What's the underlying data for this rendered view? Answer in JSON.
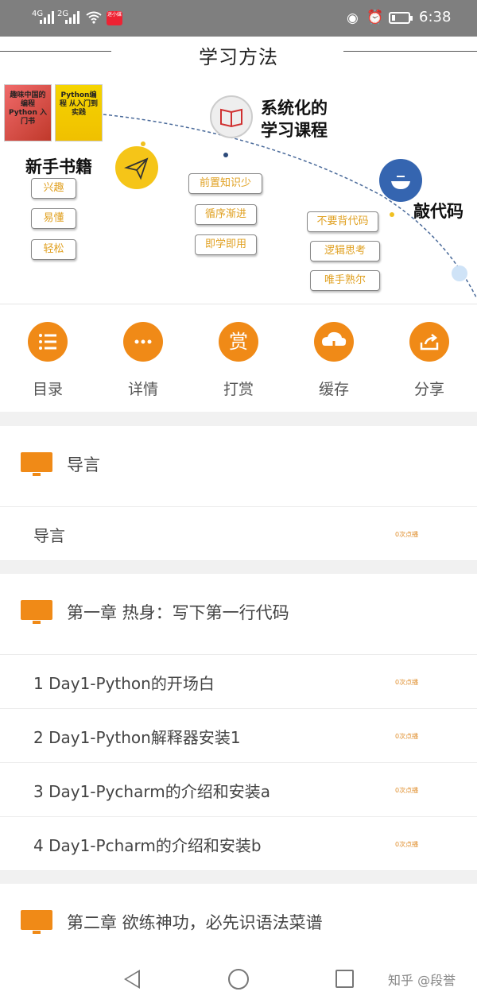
{
  "status_bar": {
    "signal1": "4G",
    "signal2": "2G",
    "app_badge": "迷小媒",
    "time": "6:38",
    "battery_level": 0.2
  },
  "banner": {
    "title": "学习方法",
    "book1_text": "趣味中国的编程 Python 入门书",
    "book2_text": "Python编程 从入门到实践",
    "left_label": "新手书籍",
    "center_label": "系统化的\n学习课程",
    "right_label": "敲代码",
    "left_tags": [
      "兴趣",
      "易懂",
      "轻松"
    ],
    "center_tags": [
      "前置知识少",
      "循序渐进",
      "即学即用"
    ],
    "right_tags": [
      "不要背代码",
      "逻辑思考",
      "唯手熟尔"
    ]
  },
  "actions": [
    {
      "label": "目录",
      "icon": "list-icon"
    },
    {
      "label": "详情",
      "icon": "more-icon"
    },
    {
      "label": "打赏",
      "icon": "reward-icon",
      "glyph": "赏"
    },
    {
      "label": "缓存",
      "icon": "cloud-download-icon"
    },
    {
      "label": "分享",
      "icon": "share-icon"
    }
  ],
  "sections": [
    {
      "title": "导言",
      "items": [
        {
          "title": "导言",
          "plays": "0次点播"
        }
      ]
    },
    {
      "title": "第一章  热身：写下第一行代码",
      "items": [
        {
          "title": "1  Day1-Python的开场白",
          "plays": "0次点播"
        },
        {
          "title": "2  Day1-Python解释器安装1",
          "plays": "0次点播"
        },
        {
          "title": "3  Day1-Pycharm的介绍和安装a",
          "plays": "0次点播"
        },
        {
          "title": "4  Day1-Pcharm的介绍和安装b",
          "plays": "0次点播"
        }
      ]
    },
    {
      "title": "第二章  欲练神功，必先识语法菜谱",
      "items": []
    }
  ],
  "watermark": "知乎 @段誉",
  "colors": {
    "accent": "#f08a17",
    "status_bar": "#7f7f7f",
    "tag_text": "#e0a020"
  }
}
